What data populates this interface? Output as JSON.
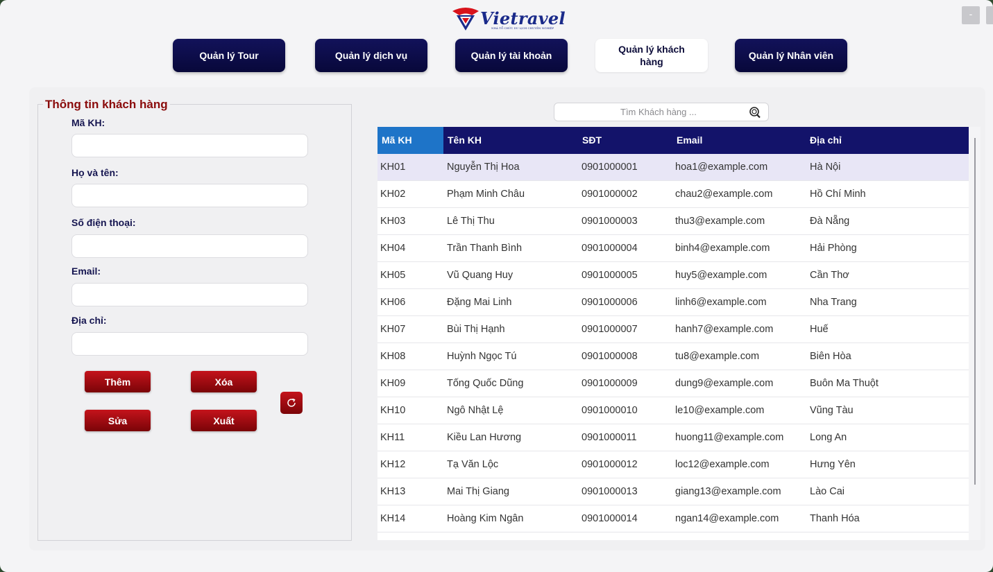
{
  "window": {
    "minimize_label": "-"
  },
  "brand": {
    "name": "Vietravel",
    "tagline": "NHÀ TỔ CHỨC DU LỊCH CHUYÊN NGHIỆP",
    "colors": {
      "red": "#d8121b",
      "blue": "#1a2a8a"
    }
  },
  "nav": [
    {
      "label": "Quản lý Tour",
      "active": false
    },
    {
      "label": "Quản lý dịch vụ",
      "active": false
    },
    {
      "label": "Quản lý tài khoản",
      "active": false
    },
    {
      "label": "Quản lý khách hàng",
      "active": true
    },
    {
      "label": "Quản lý Nhân viên",
      "active": false
    }
  ],
  "form": {
    "legend": "Thông tin khách hàng",
    "fields": [
      {
        "label": "Mã KH:",
        "value": ""
      },
      {
        "label": "Họ và tên:",
        "value": ""
      },
      {
        "label": "Số điện thoại:",
        "value": ""
      },
      {
        "label": "Email:",
        "value": ""
      },
      {
        "label": "Địa chỉ:",
        "value": ""
      }
    ],
    "buttons": {
      "add": "Thêm",
      "delete": "Xóa",
      "edit": "Sửa",
      "export": "Xuất"
    }
  },
  "search": {
    "placeholder": "Tìm Khách hàng ..."
  },
  "table": {
    "columns": [
      "Mã KH",
      "Tên KH",
      "SĐT",
      "Email",
      "Địa chỉ"
    ],
    "rows": [
      [
        "KH01",
        "Nguyễn Thị Hoa",
        "0901000001",
        "hoa1@example.com",
        "Hà Nội"
      ],
      [
        "KH02",
        "Phạm Minh Châu",
        "0901000002",
        "chau2@example.com",
        "Hồ Chí Minh"
      ],
      [
        "KH03",
        "Lê Thị Thu",
        "0901000003",
        "thu3@example.com",
        "Đà Nẵng"
      ],
      [
        "KH04",
        "Trần Thanh Bình",
        "0901000004",
        "binh4@example.com",
        "Hải Phòng"
      ],
      [
        "KH05",
        "Vũ Quang Huy",
        "0901000005",
        "huy5@example.com",
        "Cần Thơ"
      ],
      [
        "KH06",
        "Đặng Mai Linh",
        "0901000006",
        "linh6@example.com",
        "Nha Trang"
      ],
      [
        "KH07",
        "Bùi Thị Hạnh",
        "0901000007",
        "hanh7@example.com",
        "Huế"
      ],
      [
        "KH08",
        "Huỳnh Ngọc Tú",
        "0901000008",
        "tu8@example.com",
        "Biên Hòa"
      ],
      [
        "KH09",
        "Tống Quốc Dũng",
        "0901000009",
        "dung9@example.com",
        "Buôn Ma Thuột"
      ],
      [
        "KH10",
        "Ngô Nhật Lệ",
        "0901000010",
        "le10@example.com",
        "Vũng Tàu"
      ],
      [
        "KH11",
        "Kiều Lan Hương",
        "0901000011",
        "huong11@example.com",
        "Long An"
      ],
      [
        "KH12",
        "Tạ Văn Lộc",
        "0901000012",
        "loc12@example.com",
        "Hưng Yên"
      ],
      [
        "KH13",
        "Mai Thị Giang",
        "0901000013",
        "giang13@example.com",
        "Lào Cai"
      ],
      [
        "KH14",
        "Hoàng Kim Ngân",
        "0901000014",
        "ngan14@example.com",
        "Thanh Hóa"
      ]
    ],
    "selected_row": 0
  },
  "icons": {
    "search": "search-icon",
    "refresh": "refresh-icon",
    "logo": "vietravel-logo-icon"
  }
}
